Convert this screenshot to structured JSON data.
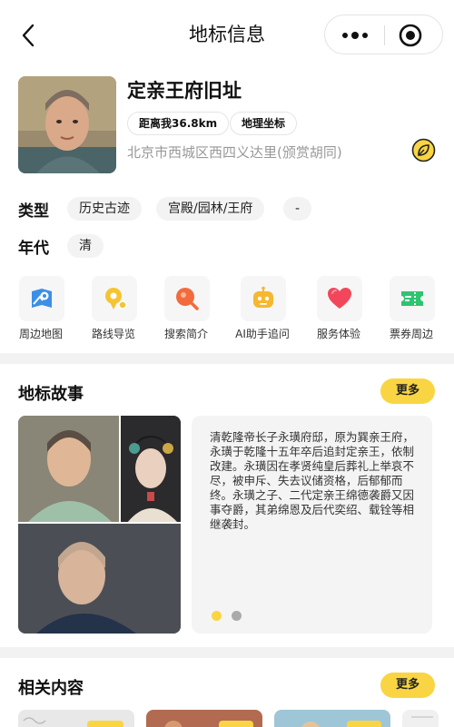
{
  "header": {
    "title": "地标信息"
  },
  "landmark": {
    "name": "定亲王府旧址",
    "distance_chip": "距离我36.8km",
    "coords_chip": "地理坐标",
    "address": "北京市西城区西四义达里(颁赏胡同)"
  },
  "info": {
    "type_label": "类型",
    "types": [
      "历史古迹",
      "宫殿/园林/王府",
      "-"
    ],
    "era_label": "年代",
    "era": "清"
  },
  "features": [
    {
      "label": "周边地图",
      "icon": "map-icon"
    },
    {
      "label": "路线导览",
      "icon": "route-icon"
    },
    {
      "label": "搜索简介",
      "icon": "search-icon"
    },
    {
      "label": "AI助手追问",
      "icon": "robot-icon"
    },
    {
      "label": "服务体验",
      "icon": "heart-icon"
    },
    {
      "label": "票券周边",
      "icon": "ticket-icon"
    }
  ],
  "story": {
    "title": "地标故事",
    "more_label": "更多",
    "text": "清乾隆帝长子永璜府邸，原为巽亲王府，永璜于乾隆十五年卒后追封定亲王，依制改建。永璜因在孝贤纯皇后葬礼上举哀不尽，被申斥、失去议储资格，后郁郁而终。永璜之子、二代定亲王绵德袭爵又因事夺爵，其弟绵恩及后代奕绍、载铨等相继袭封。",
    "pager": {
      "count": 2,
      "active": 0
    }
  },
  "related": {
    "title": "相关内容",
    "more_label": "更多"
  },
  "colors": {
    "accent": "#f9d543",
    "muted": "#999999",
    "tag_bg": "#f3f3f3",
    "section_bg": "#f2f2f2"
  }
}
